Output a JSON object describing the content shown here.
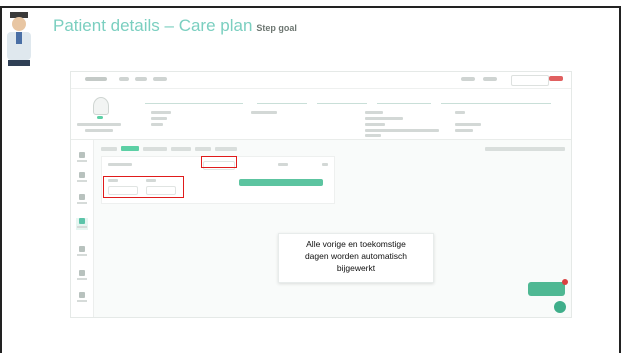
{
  "slide": {
    "title": "Patient details – Care plan",
    "step_label": "Step goal"
  },
  "tooltip": {
    "line1": "Alle vorige en toekomstige",
    "line2": "dagen worden automatisch",
    "line3": "bijgewerkt"
  },
  "colors": {
    "title_teal": "#7bcfc0",
    "accent_green": "#5cc4a0",
    "highlight_red": "#e01b1b"
  },
  "icons": [
    "doctor-avatar-icon",
    "user-avatar-icon",
    "nav-icon",
    "add-icon"
  ]
}
